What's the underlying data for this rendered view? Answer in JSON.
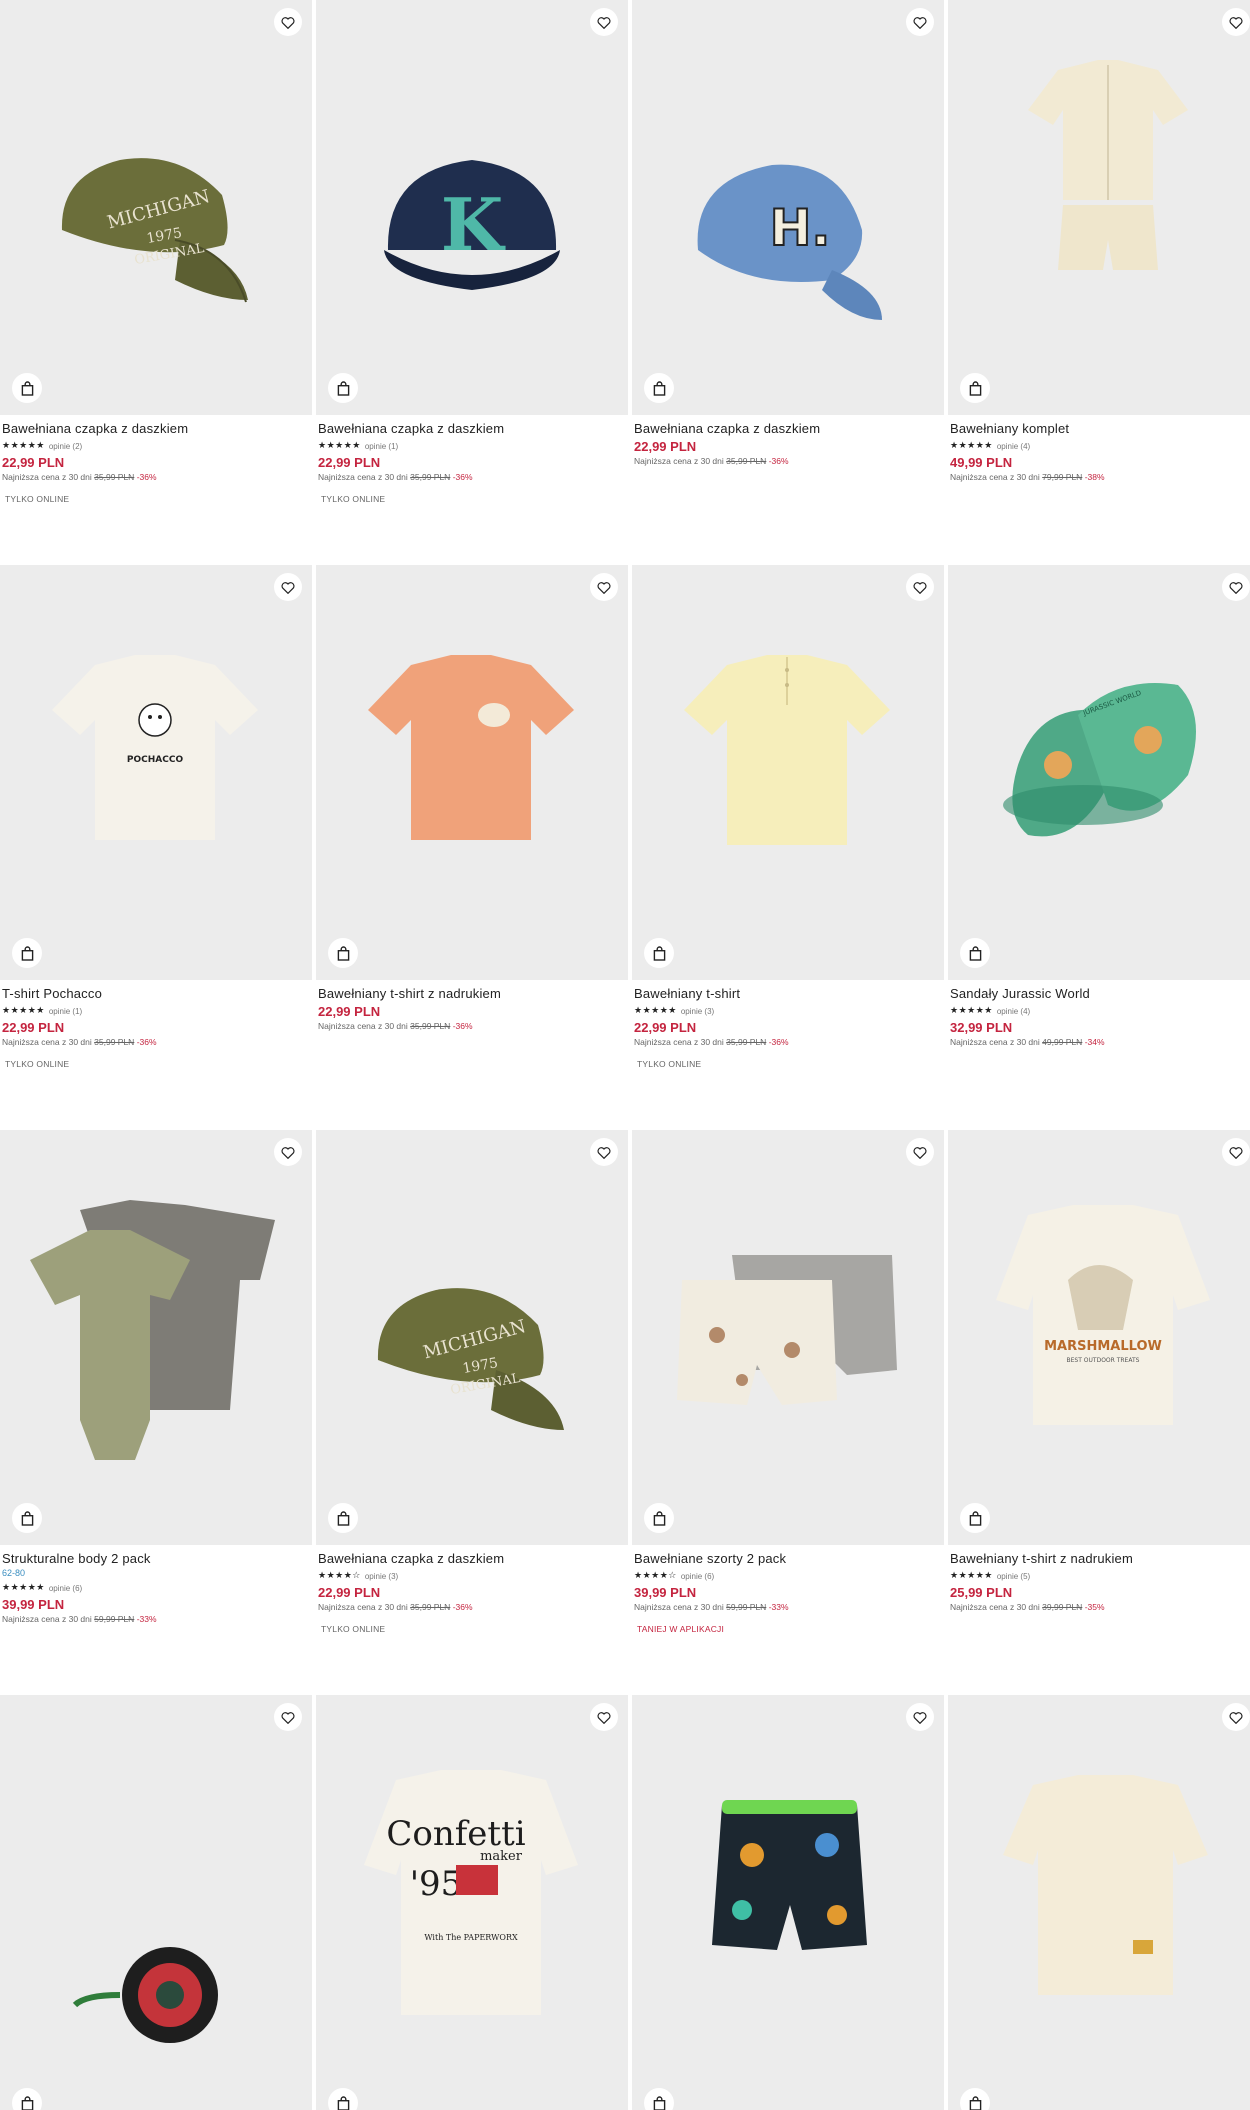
{
  "ui": {
    "heart_icon": "heart-outline-icon",
    "bag_icon": "shopping-bag-icon",
    "accent_price": "#c4243f",
    "sizes_color": "#3a8ec0"
  },
  "products": [
    {
      "name": "Bawełniana czapka z daszkiem",
      "stars": "★★★★★",
      "opinie": "opinie (2)",
      "price": "22,99 PLN",
      "lowest_label": "Najniższa cena z 30 dni",
      "old_price": "35,99 PLN",
      "discount": "-36%",
      "tag": "TYLKO ONLINE"
    },
    {
      "name": "Bawełniana czapka z daszkiem",
      "stars": "★★★★★",
      "opinie": "opinie (1)",
      "price": "22,99 PLN",
      "lowest_label": "Najniższa cena z 30 dni",
      "old_price": "35,99 PLN",
      "discount": "-36%",
      "tag": "TYLKO ONLINE"
    },
    {
      "name": "Bawełniana czapka z daszkiem",
      "price": "22,99 PLN",
      "lowest_label": "Najniższa cena z 30 dni",
      "old_price": "35,99 PLN",
      "discount": "-36%"
    },
    {
      "name": "Bawełniany komplet",
      "stars": "★★★★★",
      "opinie": "opinie (4)",
      "price": "49,99 PLN",
      "lowest_label": "Najniższa cena z 30 dni",
      "old_price": "79,99 PLN",
      "discount": "-38%"
    },
    {
      "name": "T-shirt Pochacco",
      "stars": "★★★★★",
      "opinie": "opinie (1)",
      "price": "22,99 PLN",
      "lowest_label": "Najniższa cena z 30 dni",
      "old_price": "35,99 PLN",
      "discount": "-36%",
      "tag": "TYLKO ONLINE"
    },
    {
      "name": "Bawełniany t-shirt z nadrukiem",
      "price": "22,99 PLN",
      "lowest_label": "Najniższa cena z 30 dni",
      "old_price": "35,99 PLN",
      "discount": "-36%"
    },
    {
      "name": "Bawełniany t-shirt",
      "stars": "★★★★★",
      "opinie": "opinie (3)",
      "price": "22,99 PLN",
      "lowest_label": "Najniższa cena z 30 dni",
      "old_price": "35,99 PLN",
      "discount": "-36%",
      "tag": "TYLKO ONLINE"
    },
    {
      "name": "Sandały Jurassic World",
      "stars": "★★★★★",
      "opinie": "opinie (4)",
      "price": "32,99 PLN",
      "lowest_label": "Najniższa cena z 30 dni",
      "old_price": "49,99 PLN",
      "discount": "-34%"
    },
    {
      "name": "Strukturalne body 2 pack",
      "sizes": "62-80",
      "stars": "★★★★★",
      "opinie": "opinie (6)",
      "price": "39,99 PLN",
      "lowest_label": "Najniższa cena z 30 dni",
      "old_price": "59,99 PLN",
      "discount": "-33%"
    },
    {
      "name": "Bawełniana czapka z daszkiem",
      "stars": "★★★★☆",
      "opinie": "opinie (3)",
      "price": "22,99 PLN",
      "lowest_label": "Najniższa cena z 30 dni",
      "old_price": "35,99 PLN",
      "discount": "-36%",
      "tag": "TYLKO ONLINE"
    },
    {
      "name": "Bawełniane szorty 2 pack",
      "stars": "★★★★☆",
      "opinie": "opinie (6)",
      "price": "39,99 PLN",
      "lowest_label": "Najniższa cena z 30 dni",
      "old_price": "59,99 PLN",
      "discount": "-33%",
      "tag": "TANIEJ W APLIKACJI",
      "tag_red": true
    },
    {
      "name": "Bawełniany t-shirt z nadrukiem",
      "stars": "★★★★★",
      "opinie": "opinie (5)",
      "price": "25,99 PLN",
      "lowest_label": "Najniższa cena z 30 dni",
      "old_price": "39,99 PLN",
      "discount": "-35%"
    },
    {
      "name": ""
    },
    {
      "name": ""
    },
    {
      "name": ""
    },
    {
      "name": ""
    }
  ],
  "image_text": {
    "cap_green_text": "MICHIGAN",
    "cap_green_year": "1975",
    "cap_green_original": "ORIGINAL",
    "cap_navy_letter": "K",
    "cap_blue_letter": "H.",
    "pochacco_text": "POCHACCO",
    "sandal_text": "JURASSIC WORLD",
    "marsh_text": "MARSHMALLOW",
    "marsh_sub": "BEST OUTDOOR TREATS",
    "confetti_text": "Confetti",
    "confetti_maker": "maker",
    "confetti_year": "'95",
    "confetti_sub": "With The PAPERWORX"
  }
}
